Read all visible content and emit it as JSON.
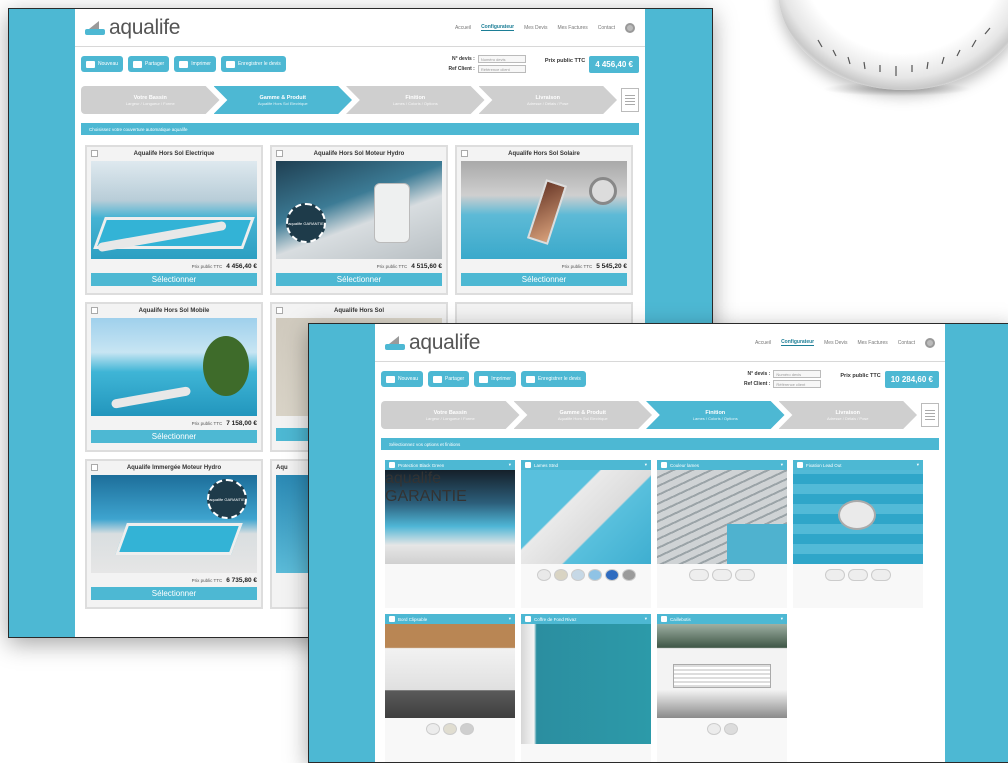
{
  "brand": {
    "name": "aqualife",
    "accent": "#4db8d3"
  },
  "nav": [
    "Accueil",
    "Configurateur",
    "Mes Devis",
    "Mes Factures",
    "Contact"
  ],
  "toolbar": {
    "buttons": [
      "Nouveau",
      "Partager",
      "Imprimer",
      "Enregistrer le devis"
    ],
    "devis_label": "N° devis :",
    "devis_placeholder": "Numéro devis",
    "client_label": "Ref Client :",
    "client_placeholder": "Référence client",
    "prix_label": "Prix public TTC",
    "prix_value_1": "4 456,40 €",
    "prix_value_2": "10 284,60 €"
  },
  "steps_1": [
    {
      "title": "Votre Bassin",
      "sub": "Largeur / Longueur / Forme"
    },
    {
      "title": "Gamme & Produit",
      "sub": "Aqualife Hors Sol Electrique"
    },
    {
      "title": "Finition",
      "sub": "Lames / Coloris / Options"
    },
    {
      "title": "Livraison",
      "sub": "Adresse / Délais / Pose"
    }
  ],
  "steps_2": [
    {
      "title": "Votre Bassin",
      "sub": "Largeur / Longueur / Forme"
    },
    {
      "title": "Gamme & Produit",
      "sub": "Aqualife Hors Sol Electrique"
    },
    {
      "title": "Finition",
      "sub": "Lames / Coloris / Options"
    },
    {
      "title": "Livraison",
      "sub": "Adresse / Délais / Pose"
    }
  ],
  "band_1": "Choisissez votre couverture automatique aqualife",
  "band_2": "Sélectionnez vos options et finitions",
  "products": [
    {
      "title": "Aqualife Hors Sol Electrique",
      "price_label": "Prix public TTC",
      "price": "4 456,40 €",
      "select": "Sélectionner"
    },
    {
      "title": "Aqualife Hors Sol Moteur Hydro",
      "price_label": "Prix public TTC",
      "price": "4 515,60 €",
      "select": "Sélectionner"
    },
    {
      "title": "Aqualife Hors Sol Solaire",
      "price_label": "Prix public TTC",
      "price": "5 545,20 €",
      "select": "Sélectionner"
    },
    {
      "title": "Aqualife Hors Sol Mobile",
      "price_label": "Prix public TTC",
      "price": "7 158,00 €",
      "select": "Sélectionner"
    },
    {
      "title": "Aqualife Hors Sol",
      "price_label": "Prix public TTC",
      "price": "",
      "select": "Sélectionner"
    },
    {
      "title": "",
      "price_label": "",
      "price": "",
      "select": ""
    },
    {
      "title": "Aqualife Immergée Moteur Hydro",
      "price_label": "Prix public TTC",
      "price": "6 735,80 €",
      "select": "Sélectionner"
    },
    {
      "title": "Aqu",
      "price_label": "",
      "price": "",
      "select": ""
    }
  ],
  "badge_text": "aqualife GARANTIE",
  "tiles": [
    {
      "title": "Protection Black Green",
      "swatches": []
    },
    {
      "title": "Lames Stnd",
      "swatches": [
        "#e9e9e9",
        "#d9d4c3",
        "#c6d8e6",
        "#8fc3e5",
        "#2f6cc0",
        "#9b9b9b"
      ]
    },
    {
      "title": "Couleur lames",
      "swatches": [
        "rect",
        "rect",
        "rect"
      ]
    },
    {
      "title": "Fixation Lead Out",
      "swatches": [
        "rect",
        "rect",
        "rect"
      ]
    },
    {
      "title": "Bord Clipsable",
      "swatches": [
        "#ececec",
        "#e0ddd0",
        "#cfcfcf"
      ]
    },
    {
      "title": "Coffre de Fond Rivaz",
      "swatches": []
    },
    {
      "title": "Caillebotis",
      "swatches": [
        "#ececec",
        "#dcdcdc"
      ]
    }
  ]
}
